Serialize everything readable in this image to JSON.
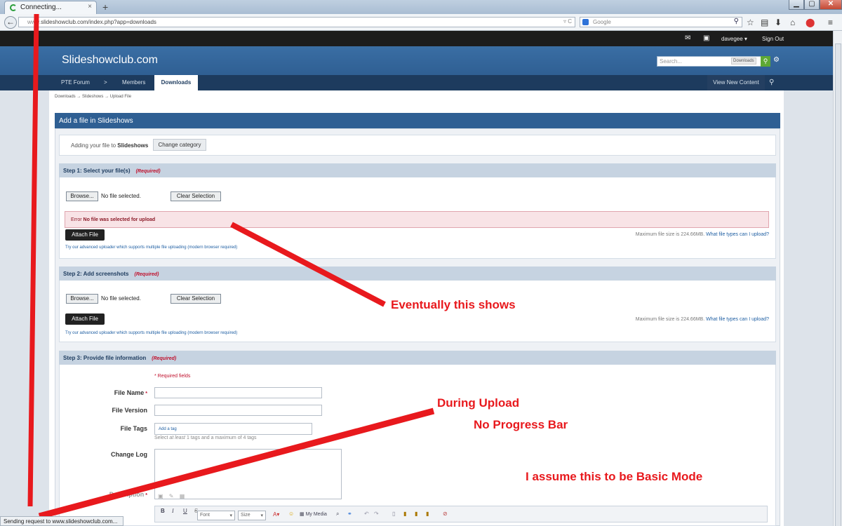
{
  "browser": {
    "tab_title": "Connecting...",
    "tab_close": "×",
    "new_tab": "+",
    "url_dim": "www.",
    "url_main": "slideshowclub.com/index.php?app=downloads",
    "search_placeholder": "Google",
    "status_text": "Sending request to www.slideshowclub.com..."
  },
  "site": {
    "username": "davegee",
    "sign_out": "Sign Out",
    "brand": "Slideshowclub.com",
    "search_placeholder": "Search...",
    "search_scope": "Downloads",
    "nav": [
      "PTE Forum",
      ">",
      "Members",
      "Downloads"
    ],
    "view_new": "View New Content"
  },
  "breadcrumb": {
    "a": "Downloads",
    "sep1": "→",
    "b": "Slideshows",
    "sep2": "→",
    "c": "Upload File"
  },
  "form": {
    "panel_title": "Add a file in Slideshows",
    "adding_prefix": "Adding your file to",
    "category": "Slideshows",
    "change_category": "Change category",
    "required_tag": "(Required)",
    "step1_title": "Step 1: Select your file(s)",
    "step2_title": "Step 2: Add screenshots",
    "step3_title": "Step 3: Provide file information",
    "browse": "Browse...",
    "no_file": "No file selected.",
    "clear_selection": "Clear Selection",
    "error_prefix": "Error",
    "error_msg": "No file was selected for upload",
    "attach": "Attach File",
    "max_size": "Maximum file size is 224.66MB.",
    "file_types_link": "What file types can I upload?",
    "advanced_uploader": "Try our advanced uploader which supports multiple file uploading (modern browser required)",
    "required_fields": "* Required fields",
    "file_name": "File Name",
    "file_version": "File Version",
    "file_tags": "File Tags",
    "tag_placeholder": "Add a tag",
    "tag_hint_1": "Select",
    "tag_hint_em": "at least",
    "tag_hint_2": "1 tags and a maximum of 4 tags",
    "change_log": "Change Log",
    "description": "Description",
    "font_select": "Font",
    "size_select": "Size",
    "my_media": "My Media"
  },
  "annotations": {
    "a1": "Eventually this shows",
    "a2": "During Upload",
    "a3": "No Progress Bar",
    "a4": "I assume this to be Basic Mode"
  },
  "colors": {
    "annotation_red": "#e8191d",
    "header_blue": "#2f5f93",
    "nav_dark": "#1d3b5e",
    "required_red": "#c0102c",
    "link_blue": "#1f5fa3"
  }
}
